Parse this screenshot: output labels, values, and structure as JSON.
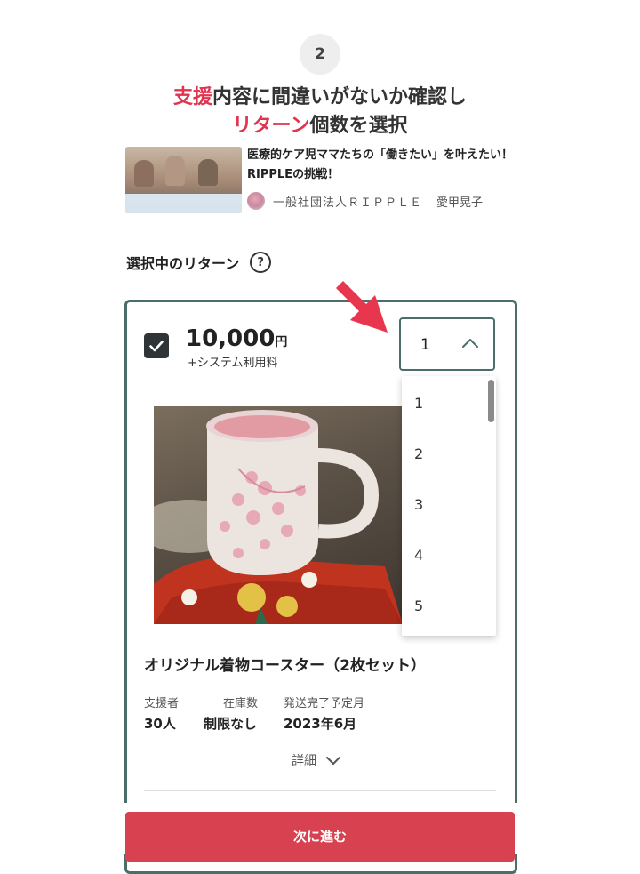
{
  "step": {
    "number": "2"
  },
  "heading": {
    "line1_highlight": "支援",
    "line1_rest": "内容に間違いがないか確認し",
    "line2_highlight": "リターン",
    "line2_rest": "個数を選択"
  },
  "project": {
    "title": "医療的ケア児ママたちの「働きたい」を叶えたい！RIPPLEの挑戦！",
    "organization": "一般社団法人ＲＩＰＰＬＥ",
    "owner": "愛甲晃子"
  },
  "section": {
    "label": "選択中のリターン",
    "help_icon": "?"
  },
  "reward": {
    "checked": true,
    "price": "10,000",
    "currency": "円",
    "fee_note": "+システム利用料",
    "quantity": "1",
    "quantity_options": [
      "1",
      "2",
      "3",
      "4",
      "5"
    ],
    "title": "オリジナル着物コースター（2枚セット）",
    "stats": [
      {
        "label": "支援者",
        "value": "30人"
      },
      {
        "label": "在庫数",
        "value": "制限なし"
      },
      {
        "label": "発送完了予定月",
        "value": "2023年6月"
      }
    ],
    "details_label": "詳細"
  },
  "footer": {
    "next_label": "次に進む"
  },
  "colors": {
    "accent": "#e0344f",
    "button": "#d8414f",
    "card_border": "#4b6e6b",
    "arrow": "#e8364f"
  },
  "icons": {
    "help": "question-circle-icon",
    "checkbox": "checkmark-icon",
    "select": "chevron-up-icon",
    "details": "chevron-down-icon",
    "pointer": "red-arrow-icon"
  }
}
